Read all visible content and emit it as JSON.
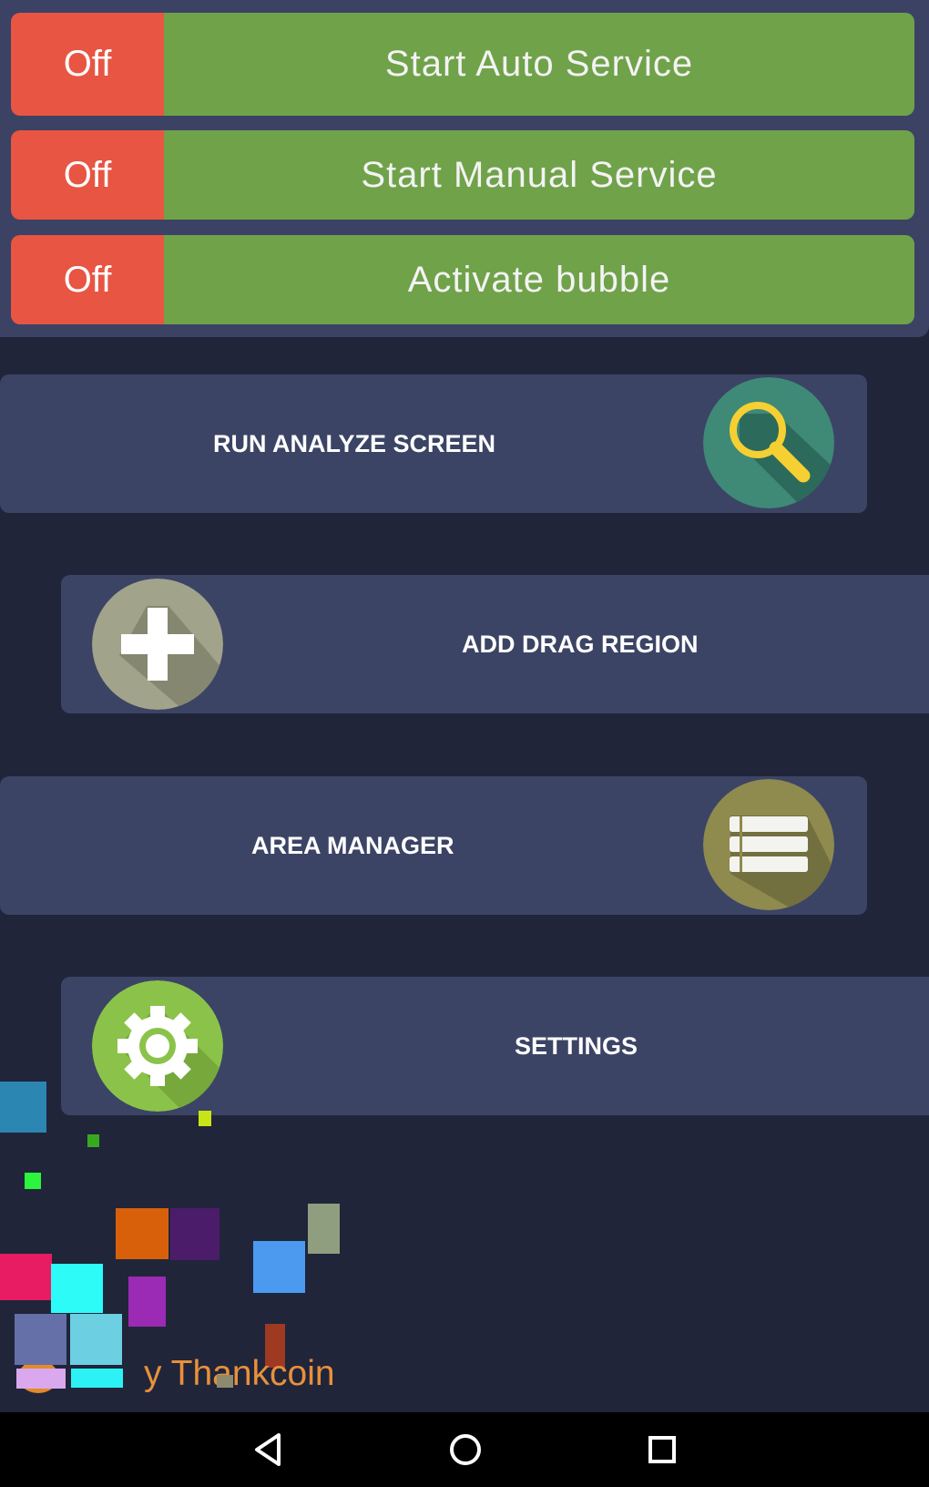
{
  "toggles": [
    {
      "state": "Off",
      "label": "Start Auto Service"
    },
    {
      "state": "Off",
      "label": "Start Manual Service"
    },
    {
      "state": "Off",
      "label": "Activate bubble"
    }
  ],
  "menu": {
    "analyze": "RUN ANALYZE SCREEN",
    "drag": "ADD DRAG REGION",
    "area": "AREA MANAGER",
    "settings": "SETTINGS"
  },
  "footer": {
    "thank_text": "y Thankcoin"
  },
  "icons": {
    "analyze": "magnifier-icon",
    "drag": "plus-icon",
    "area": "list-icon",
    "settings": "gear-icon"
  },
  "colors": {
    "off": "#e85543",
    "toggle_on_bg": "#70a24a",
    "card_bg": "#3c4465",
    "page_bg": "#20253a",
    "accent_text": "#e8903a"
  },
  "navigation": [
    "back",
    "home",
    "recents"
  ]
}
